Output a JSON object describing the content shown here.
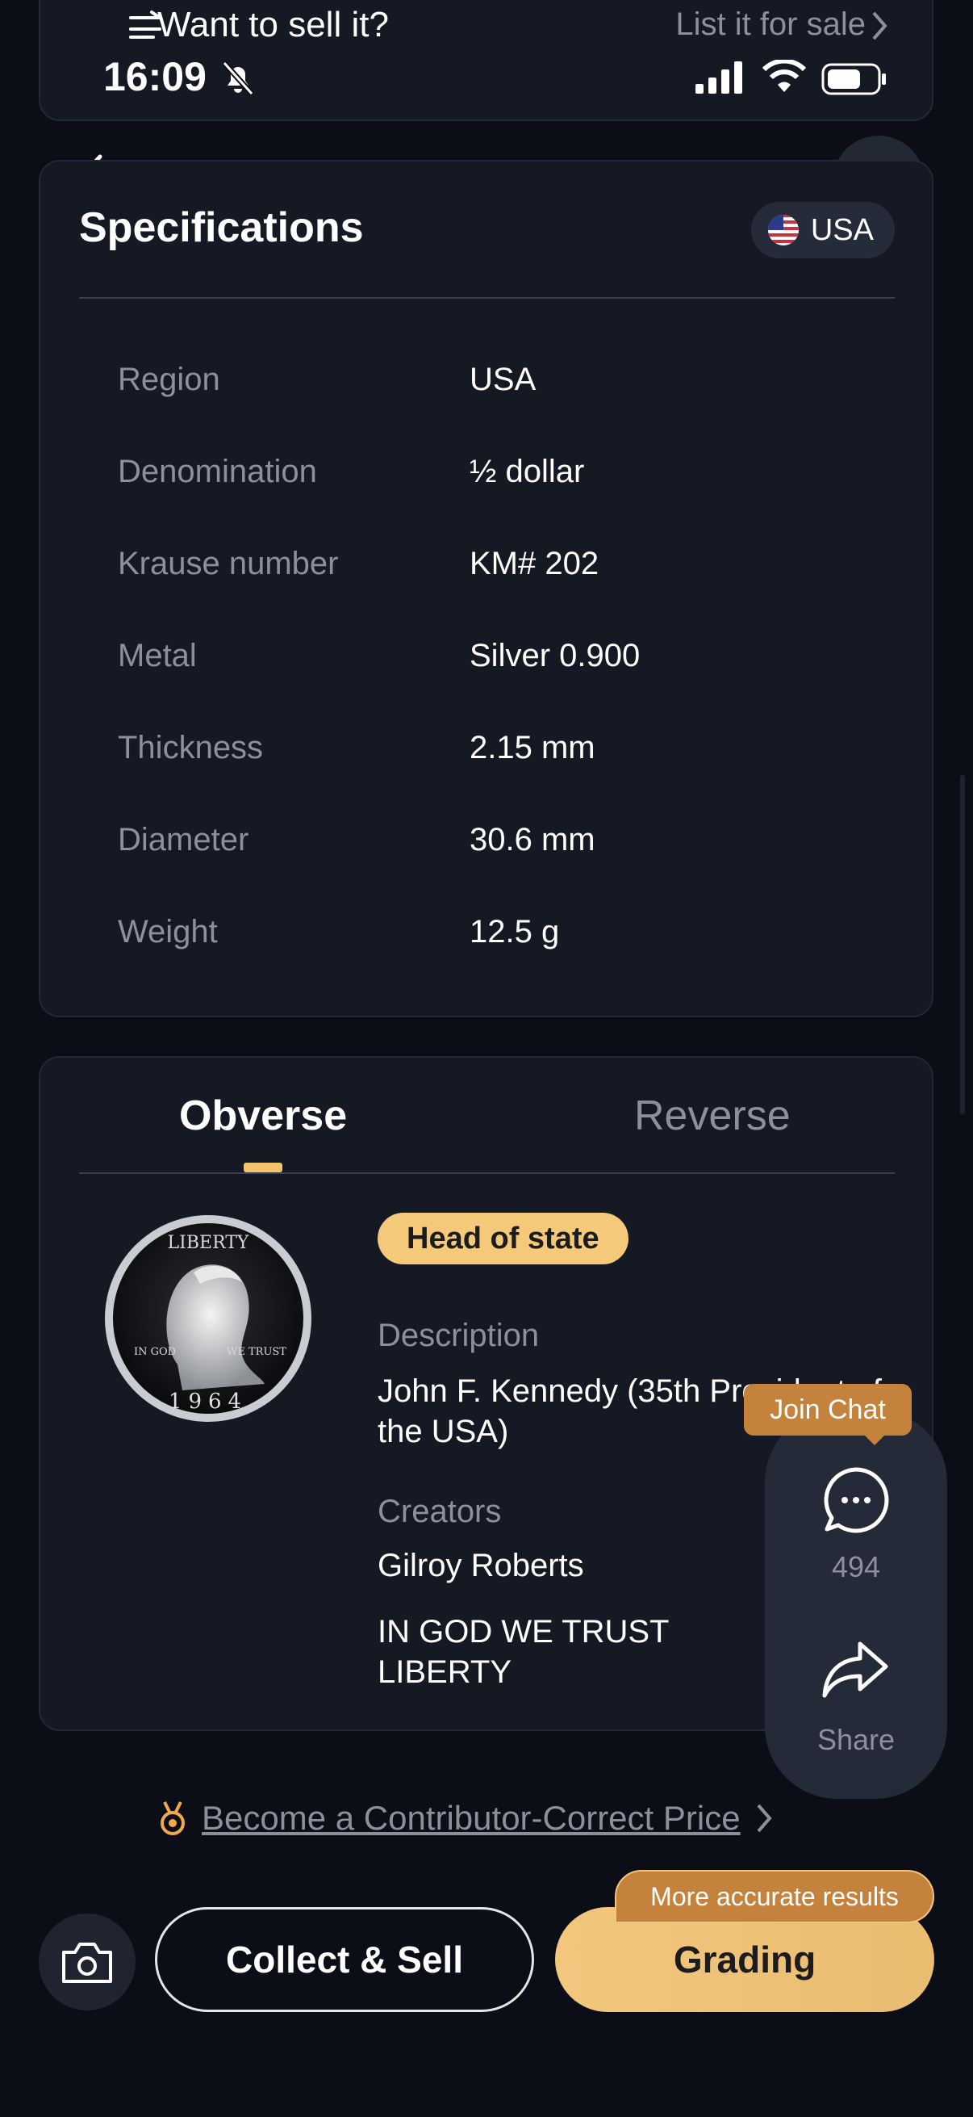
{
  "sell_bar": {
    "title": "Want to sell it?",
    "link": "List it for sale"
  },
  "status_bar": {
    "time": "16:09"
  },
  "specifications": {
    "title": "Specifications",
    "country_chip": "USA",
    "rows": [
      {
        "label": "Region",
        "value": "USA"
      },
      {
        "label": "Denomination",
        "value": "½ dollar"
      },
      {
        "label": "Krause number",
        "value": "KM# 202"
      },
      {
        "label": "Metal",
        "value": "Silver 0.900"
      },
      {
        "label": "Thickness",
        "value": "2.15 mm"
      },
      {
        "label": "Diameter",
        "value": "30.6 mm"
      },
      {
        "label": "Weight",
        "value": "12.5 g"
      }
    ]
  },
  "images": {
    "tabs": [
      "Obverse",
      "Reverse"
    ],
    "badge": "Head of state",
    "description_label": "Description",
    "description": "John F. Kennedy (35th President of the USA)",
    "creators_label": "Creators",
    "creator": "Gilroy Roberts",
    "inscription": "IN GOD WE TRUST LIBERTY",
    "coin_text": {
      "top": "LIBERTY",
      "left": "IN GOD",
      "right": "WE TRUST",
      "year": "1964"
    }
  },
  "float_panel": {
    "join_chat": "Join Chat",
    "chat_count": "494",
    "share": "Share"
  },
  "contributor": {
    "link": "Become a Contributor-Correct Price"
  },
  "bottom": {
    "collect_label": "Collect & Sell",
    "grading_label": "Grading",
    "accurate_tag": "More accurate results"
  },
  "colors": {
    "accent": "#f2c67d",
    "background": "#0b0e17",
    "card": "#151923",
    "tag": "#c4823c"
  },
  "icons": [
    "filter-icon",
    "chevron-right-icon",
    "bell-off-icon",
    "signal-icon",
    "wifi-icon",
    "battery-icon",
    "back-icon",
    "edit-icon",
    "us-flag-icon",
    "chat-icon",
    "share-icon",
    "medal-icon",
    "camera-icon"
  ]
}
